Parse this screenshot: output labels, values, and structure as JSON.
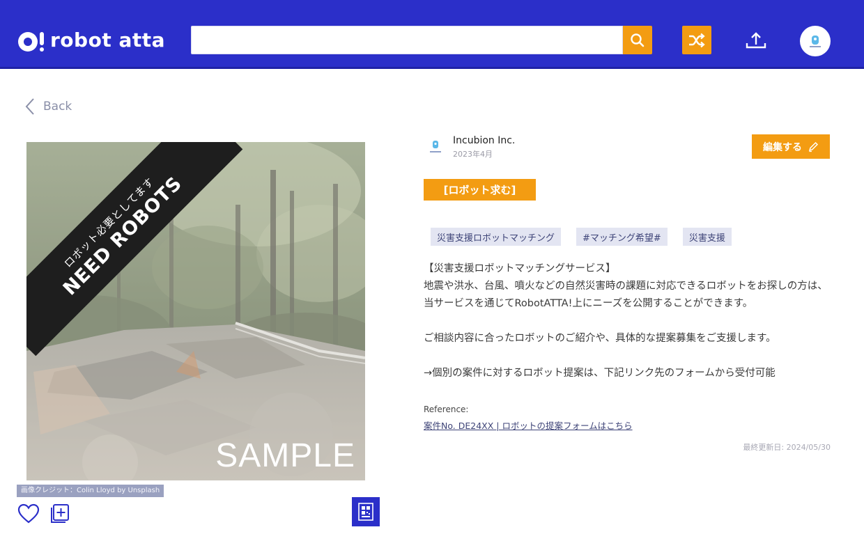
{
  "header": {
    "logo_text": "robot atta",
    "search_value": "",
    "brand_color": "#2b2fc9",
    "accent_color": "#f39c12",
    "icons": [
      "search-icon",
      "shuffle-icon",
      "upload-icon",
      "avatar-icon"
    ]
  },
  "nav": {
    "back_label": "Back"
  },
  "hero": {
    "sample_label": "SAMPLE",
    "banner_small": "ロボット必要としてます",
    "banner_big": "NEED ROBOTS",
    "credit": "画像クレジット：Colin Lloyd by Unsplash"
  },
  "post": {
    "org_name": "Incubion Inc.",
    "org_date": "2023年4月",
    "edit_label": "編集する",
    "type_badge": "[ロボット求む]",
    "tags": [
      "災害支援ロボットマッチング",
      "#マッチング希望#",
      "災害支援"
    ],
    "description": {
      "line1": "【災害支援ロボットマッチングサービス】",
      "line2": "地震や洪水、台風、噴火などの自然災害時の課題に対応できるロボットをお探しの方は、当サービスを通じてRobotATTA!上にニーズを公開することができます。",
      "line3": "ご相談内容に合ったロボットのご紹介や、具体的な提案募集をご支援します。",
      "line4": "→個別の案件に対するロボット提案は、下記リンク先のフォームから受付可能"
    },
    "reference_label": "Reference:",
    "reference_link": "案件No. DE24XX | ロボットの提案フォームはこちら",
    "last_updated": "最終更新日: 2024/05/30"
  }
}
